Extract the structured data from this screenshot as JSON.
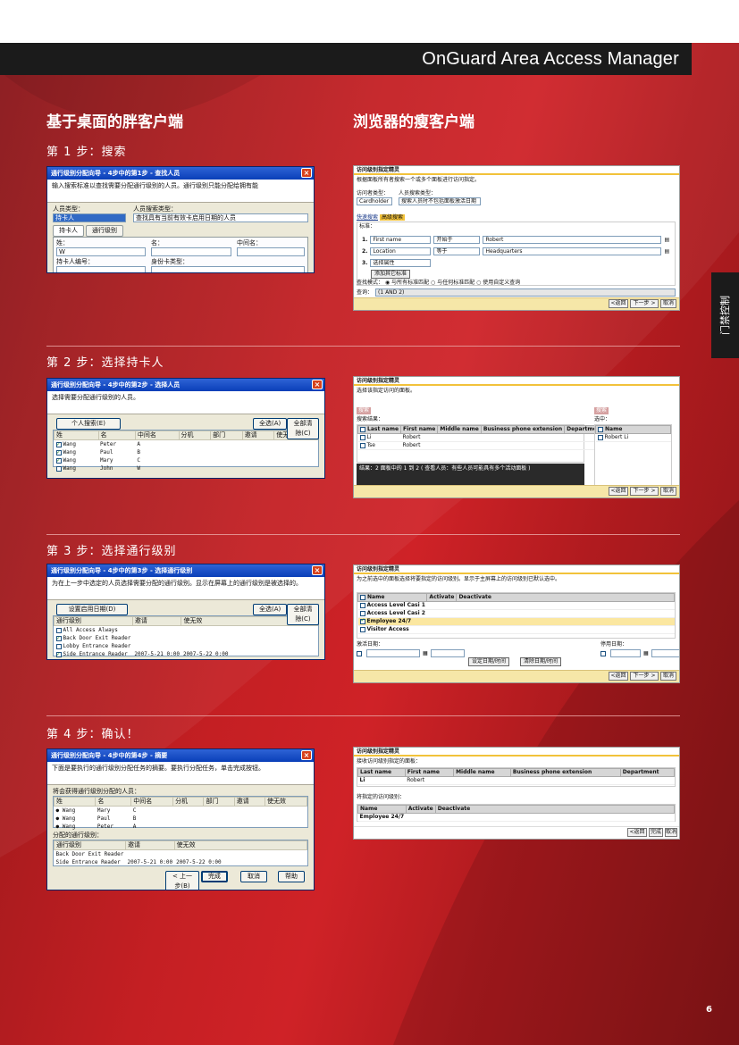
{
  "header": {
    "title": "OnGuard Area Access Manager"
  },
  "side_tab": "门禁控制",
  "page_number": "6",
  "columns": {
    "left": "基于桌面的胖客户端",
    "right": "浏览器的瘦客户端"
  },
  "steps": [
    "第 1 步：搜索",
    "第 2 步：选择持卡人",
    "第 3 步：选择通行级别",
    "第 4 步：确认！"
  ],
  "thick": {
    "s1": {
      "title": "通行级别分配向导 - 4步中的第1步 - 查找人员",
      "desc": "输入搜索标准以查找需要分配通行级别的人员。通行级别只能分配给拥有能",
      "f1_label": "人员类型：",
      "f1_value": "持卡人",
      "f2_label": "人员搜索类型：",
      "f2_value": "查找具有当前有效卡启用日期的人员",
      "tab1": "持卡人",
      "tab2": "通行级别",
      "l_last": "姓：",
      "l_first": "名：",
      "l_mid": "中间名：",
      "last_value": "W",
      "l_badge": "持卡人编号：",
      "l_badgetype": "身份卡类型："
    },
    "s2": {
      "title": "通行级别分配向导 - 4步中的第2步 - 选择人员",
      "desc": "选择需要分配通行级别的人员。",
      "btn_person": "个人搜索(E)",
      "btn_all": "全选(A)",
      "btn_clear": "全部清除(C)",
      "cols": [
        "姓",
        "名",
        "中间名",
        "分机",
        "部门",
        "邀请",
        "使无效"
      ],
      "rows": [
        [
          "Wang",
          "Peter",
          "A"
        ],
        [
          "Wang",
          "Paul",
          "B"
        ],
        [
          "Wang",
          "Mary",
          "C"
        ],
        [
          "Wang",
          "John",
          "W"
        ]
      ],
      "checked": [
        true,
        true,
        true,
        false
      ]
    },
    "s3": {
      "title": "通行级别分配向导 - 4步中的第3步 - 选择通行级别",
      "desc": "为在上一步中选定的人员选择需要分配的通行级别。显示在屏幕上的通行级别是被选择的。",
      "btn_dates": "设置启用日期(D)",
      "btn_all": "全选(A)",
      "btn_clear": "全部清除(C)",
      "cols": [
        "通行级别",
        "邀请",
        "使无效"
      ],
      "rows": [
        [
          "All Access Always",
          "",
          ""
        ],
        [
          "Back Door Exit Reader",
          "",
          ""
        ],
        [
          "Lobby Entrance Reader",
          "",
          ""
        ],
        [
          "Side Entrance Reader",
          "2007-5-21 0:00",
          "2007-5-22 0:00"
        ]
      ],
      "checked": [
        false,
        true,
        false,
        true
      ]
    },
    "s4": {
      "title": "通行级别分配向导 - 4步中的第4步 - 摘要",
      "desc": "下面是要执行的通行级别分配任务的摘要。要执行分配任务，单击完成按钮。",
      "people_label": "将会获得通行级别分配的人员：",
      "pcols": [
        "姓",
        "名",
        "中间名",
        "分机",
        "部门",
        "邀请",
        "使无效"
      ],
      "people": [
        [
          "Wang",
          "Mary",
          "C"
        ],
        [
          "Wang",
          "Paul",
          "B"
        ],
        [
          "Wang",
          "Peter",
          "A"
        ]
      ],
      "levels_label": "分配的通行级别：",
      "lcols": [
        "通行级别",
        "邀请",
        "使无效"
      ],
      "levels": [
        [
          "Back Door Exit Reader",
          "",
          ""
        ],
        [
          "Side Entrance Reader",
          "2007-5-21 0:00",
          "2007-5-22 0:00"
        ]
      ],
      "back": "< 上一步(B)",
      "finish": "完成",
      "cancel": "取消",
      "help": "帮助"
    }
  },
  "thin": {
    "title": "访问级别指定精灵",
    "s1": {
      "ins": "根据面板所有者搜索一个或多个面板进行访问指定。",
      "sel1_label": "访问者类型：",
      "sel1": "Cardholder",
      "sel2_label": "人员搜索类型：",
      "sel2": "搜索人员时不包括面板激活日期",
      "tab1": "快速搜索",
      "tab2": "高级搜索",
      "crit": "标准：",
      "rows": [
        {
          "n": "1.",
          "field": "First name",
          "op": "开始于",
          "val": "Robert"
        },
        {
          "n": "2.",
          "field": "Location",
          "op": "等于",
          "val": "Headquarters"
        },
        {
          "n": "3.",
          "field": "选择属性",
          "op": "",
          "val": ""
        }
      ],
      "add": "添加其它标准",
      "mode_label": "查找模式：",
      "mode1": "与所有标准匹配",
      "mode2": "与任何标准匹配",
      "mode3": "使用自定义查询",
      "query_label": "查询：",
      "query": "(1 AND 2)",
      "back": "<返回",
      "next": "下一步 >",
      "cancel": "取消"
    },
    "s2": {
      "ins": "选择该指定访问的面板。",
      "search_link": "搜索",
      "results_label": "搜索结果：",
      "cols": [
        "Last name",
        "First name",
        "Middle name",
        "Business phone extension",
        "Department"
      ],
      "rows": [
        [
          "Li",
          "Robert"
        ],
        [
          "Tse",
          "Robert"
        ]
      ],
      "selected_label": "选中：",
      "sel_col": "Name",
      "sel_row": "Robert Li",
      "note": "结果：2 面板中的 1 到 2 ( 查看人员：有些人员可能具有多个活动面板 )",
      "back": "<返回",
      "next": "下一步 >",
      "cancel": "取消"
    },
    "s3": {
      "ins": "为之前选中的面板选择将要指定的访问级别。显示于主屏幕上的访问级别已默认选中。",
      "cols": [
        "Name",
        "Activate",
        "Deactivate"
      ],
      "rows": [
        "Access Level Casi 1",
        "Access Level Casi 2",
        "Employee 24/7",
        "Visitor Access"
      ],
      "checked": [
        false,
        false,
        true,
        false
      ],
      "act_label": "激活日期：",
      "deact_label": "停用日期：",
      "set_btn": "设定日期/时间",
      "clear_btn": "清除日期/时间",
      "back": "<返回",
      "next": "下一步 >",
      "cancel": "取消"
    },
    "s4": {
      "l1": "接收访问级别指定的面板：",
      "cols": [
        "Last name",
        "First name",
        "Middle name",
        "Business phone extension",
        "Department"
      ],
      "row": [
        "Li",
        "Robert"
      ],
      "l2": "将指定的访问级别：",
      "cols2": [
        "Name",
        "Activate",
        "Deactivate"
      ],
      "row2": "Employee 24/7",
      "back": "<返回",
      "finish": "完成",
      "cancel": "取消"
    }
  }
}
